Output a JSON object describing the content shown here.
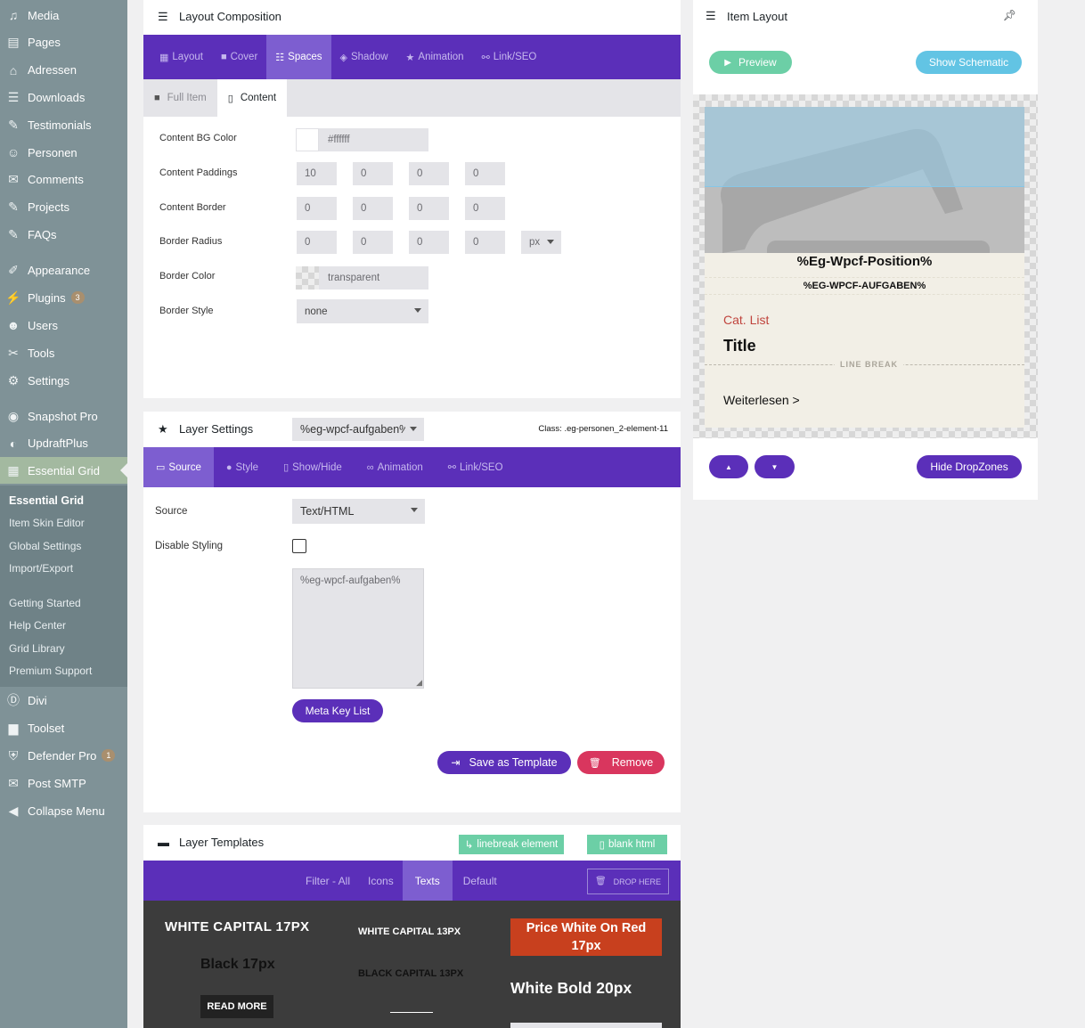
{
  "sidebar": {
    "items_top": [
      {
        "label": "Media",
        "icon": "media-icon",
        "glyph": "♫"
      },
      {
        "label": "Pages",
        "icon": "pages-icon",
        "glyph": "▤"
      },
      {
        "label": "Adressen",
        "icon": "store-icon",
        "glyph": "⌂"
      },
      {
        "label": "Downloads",
        "icon": "list-icon",
        "glyph": "☰"
      },
      {
        "label": "Testimonials",
        "icon": "pin-icon",
        "glyph": "✎"
      },
      {
        "label": "Personen",
        "icon": "person-icon",
        "glyph": "☺"
      },
      {
        "label": "Comments",
        "icon": "comment-icon",
        "glyph": "✉"
      },
      {
        "label": "Projects",
        "icon": "pin-icon",
        "glyph": "✎"
      },
      {
        "label": "FAQs",
        "icon": "pin-icon",
        "glyph": "✎"
      }
    ],
    "items_mid": [
      {
        "label": "Appearance",
        "icon": "brush-icon",
        "glyph": "✐"
      },
      {
        "label": "Plugins",
        "icon": "plugin-icon",
        "glyph": "⚡",
        "badge": "3"
      },
      {
        "label": "Users",
        "icon": "user-icon",
        "glyph": "☻"
      },
      {
        "label": "Tools",
        "icon": "wrench-icon",
        "glyph": "✂"
      },
      {
        "label": "Settings",
        "icon": "settings-icon",
        "glyph": "⚙"
      }
    ],
    "items_plugins": [
      {
        "label": "Snapshot Pro",
        "icon": "snapshot-icon",
        "glyph": "◉"
      },
      {
        "label": "UpdraftPlus",
        "icon": "updraft-icon",
        "glyph": "◐"
      },
      {
        "label": "Essential Grid",
        "icon": "grid-icon",
        "glyph": "▦"
      }
    ],
    "submenu": [
      "Essential Grid",
      "Item Skin Editor",
      "Global Settings",
      "Import/Export",
      "Getting Started",
      "Help Center",
      "Grid Library",
      "Premium Support"
    ],
    "items_bottom": [
      {
        "label": "Divi",
        "icon": "divi-icon",
        "glyph": "Ⓓ"
      },
      {
        "label": "Toolset",
        "icon": "toolset-icon",
        "glyph": "▆"
      },
      {
        "label": "Defender Pro",
        "icon": "shield-icon",
        "glyph": "⛨",
        "badge": "1"
      },
      {
        "label": "Post SMTP",
        "icon": "mail-icon",
        "glyph": "✉"
      },
      {
        "label": "Collapse Menu",
        "icon": "collapse-icon",
        "glyph": "◀"
      }
    ]
  },
  "layout_composition": {
    "title": "Layout Composition",
    "tabs": [
      "Layout",
      "Cover",
      "Spaces",
      "Shadow",
      "Animation",
      "Link/SEO"
    ],
    "subtabs": [
      "Full Item",
      "Content"
    ],
    "fields": {
      "bg_color_label": "Content BG Color",
      "bg_color_value": "#ffffff",
      "paddings_label": "Content Paddings",
      "paddings": [
        "10",
        "0",
        "0",
        "0"
      ],
      "border_label": "Content Border",
      "border": [
        "0",
        "0",
        "0",
        "0"
      ],
      "radius_label": "Border Radius",
      "radius": [
        "0",
        "0",
        "0",
        "0"
      ],
      "radius_unit": "px",
      "border_color_label": "Border Color",
      "border_color_value": "transparent",
      "border_style_label": "Border Style",
      "border_style_value": "none"
    }
  },
  "item_layout": {
    "title": "Item Layout",
    "preview_btn": "Preview",
    "schematic_btn": "Show Schematic",
    "card": {
      "position": "%Eg-Wpcf-Position%",
      "aufgaben": "%EG-WPCF-AUFGABEN%",
      "cat_list": "Cat. List",
      "title": "Title",
      "line_break": "LINE BREAK",
      "weiterlesen": "Weiterlesen >"
    },
    "hide_dropzones_btn": "Hide DropZones"
  },
  "layer_settings": {
    "title": "Layer Settings",
    "layer_select": "%eg-wpcf-aufgaben%",
    "class_text": "Class: .eg-personen_2-element-11",
    "tabs": [
      "Source",
      "Style",
      "Show/Hide",
      "Animation",
      "Link/SEO"
    ],
    "source_label": "Source",
    "source_value": "Text/HTML",
    "disable_styling_label": "Disable Styling",
    "textarea_value": "%eg-wpcf-aufgaben%",
    "meta_key_btn": "Meta Key List",
    "save_template_btn": "Save as Template",
    "remove_btn": "Remove"
  },
  "layer_templates": {
    "title": "Layer Templates",
    "linebreak_btn": "linebreak element",
    "blank_btn": "blank html",
    "filters": [
      "Filter - All",
      "Icons",
      "Texts",
      "Default"
    ],
    "drop_here": "DROP HERE",
    "samples": {
      "white_capital_17": "WHITE CAPITAL 17PX",
      "black_17": "Black 17px",
      "read_more": "READ MORE",
      "white_capital_13": "WHITE CAPITAL 13PX",
      "black_capital_13": "BLACK CAPITAL 13PX",
      "price_white_on_red": "Price White On Red 17px",
      "white_bold_20": "White Bold 20px"
    }
  },
  "colors": {
    "accent_purple": "#5b2fb9",
    "preview_green": "#6ccfa6",
    "schematic_blue": "#62c4e4",
    "remove_red": "#d9365e",
    "sidebar_bg": "#7f9297"
  }
}
